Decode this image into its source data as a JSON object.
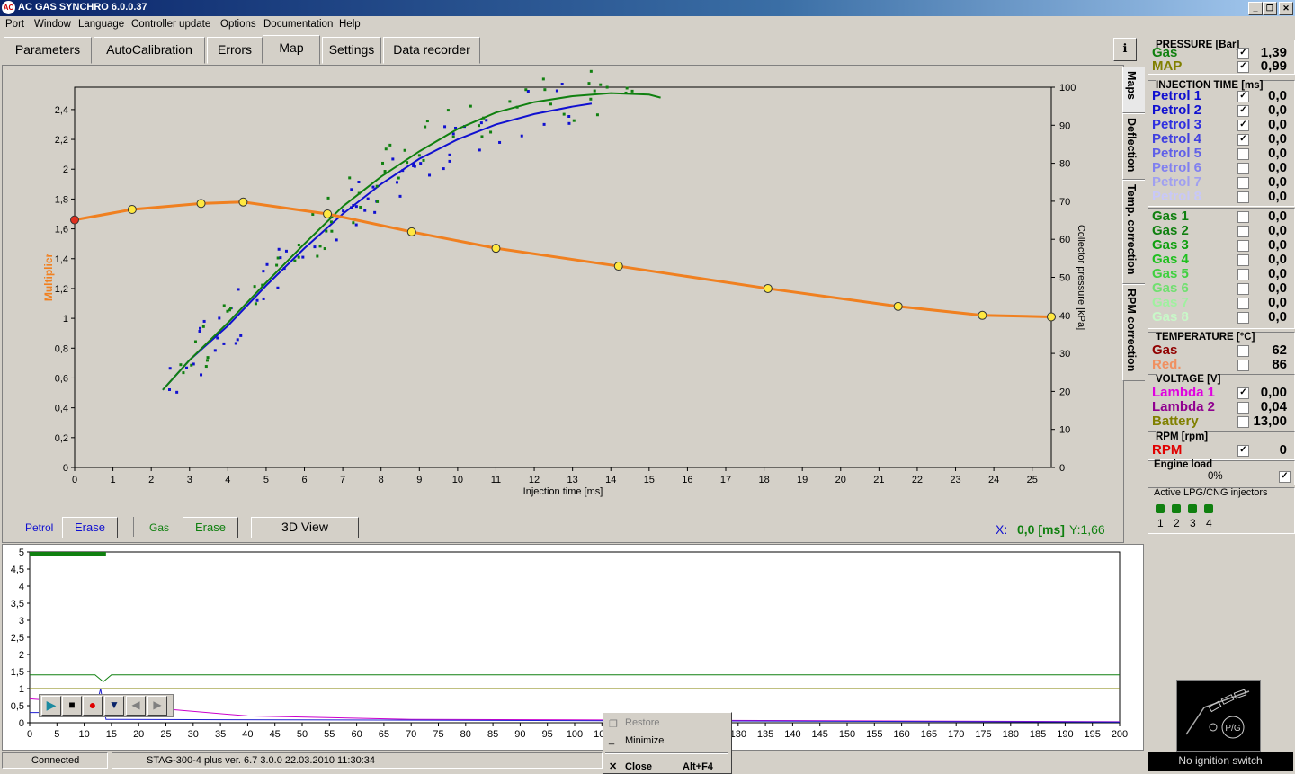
{
  "window": {
    "title": "AC GAS SYNCHRO  6.0.0.37",
    "icon": "AC"
  },
  "menu": [
    "Port",
    "Window",
    "Language",
    "Controller update",
    "Options",
    "Documentation",
    "Help"
  ],
  "tabs": [
    "Parameters",
    "AutoCalibration",
    "Errors",
    "Map",
    "Settings",
    "Data recorder"
  ],
  "active_tab": "Map",
  "vertical_tabs": [
    "Maps",
    "Deflection",
    "Temp. correction",
    "RPM correction"
  ],
  "chart_data": [
    {
      "type": "line",
      "xlabel": "Injection time [ms]",
      "ylabel": "Multiplier",
      "y2label": "Collector pressure [kPa]",
      "xlim": [
        0,
        25.5
      ],
      "ylim": [
        0,
        2.55
      ],
      "y2lim": [
        0,
        100
      ],
      "x_ticks": [
        0,
        1,
        2,
        3,
        4,
        5,
        6,
        7,
        8,
        9,
        10,
        11,
        12,
        13,
        14,
        15,
        16,
        17,
        18,
        19,
        20,
        21,
        22,
        23,
        24,
        25
      ],
      "y_ticks": [
        "0",
        "0,2",
        "0,4",
        "0,6",
        "0,8",
        "1",
        "1,2",
        "1,4",
        "1,6",
        "1,8",
        "2",
        "2,2",
        "2,4"
      ],
      "y2_ticks": [
        "0",
        "10",
        "20",
        "30",
        "40",
        "50",
        "60",
        "70",
        "80",
        "90",
        "100"
      ],
      "multiplier_curve": {
        "color": "#f08020",
        "points": [
          [
            0,
            1.66
          ],
          [
            1.5,
            1.73
          ],
          [
            3.3,
            1.77
          ],
          [
            4.4,
            1.78
          ],
          [
            6.6,
            1.7
          ],
          [
            8.8,
            1.58
          ],
          [
            11,
            1.47
          ],
          [
            14.2,
            1.35
          ],
          [
            18.1,
            1.2
          ],
          [
            21.5,
            1.08
          ],
          [
            23.7,
            1.02
          ],
          [
            25.5,
            1.01
          ]
        ]
      },
      "series": [
        {
          "name": "Petrol",
          "color": "#1010d0",
          "trend": [
            [
              2.3,
              0.52
            ],
            [
              3,
              0.72
            ],
            [
              4,
              0.95
            ],
            [
              5,
              1.22
            ],
            [
              6,
              1.47
            ],
            [
              7,
              1.7
            ],
            [
              8,
              1.9
            ],
            [
              9,
              2.07
            ],
            [
              10,
              2.2
            ],
            [
              11,
              2.3
            ],
            [
              12,
              2.37
            ],
            [
              13,
              2.42
            ],
            [
              13.5,
              2.44
            ]
          ]
        },
        {
          "name": "Gas",
          "color": "#108010",
          "trend": [
            [
              2.3,
              0.52
            ],
            [
              3,
              0.72
            ],
            [
              4,
              0.97
            ],
            [
              5,
              1.24
            ],
            [
              6,
              1.5
            ],
            [
              7,
              1.75
            ],
            [
              8,
              1.95
            ],
            [
              9,
              2.12
            ],
            [
              10,
              2.27
            ],
            [
              11,
              2.38
            ],
            [
              12,
              2.45
            ],
            [
              13,
              2.49
            ],
            [
              14,
              2.51
            ],
            [
              15,
              2.5
            ],
            [
              15.3,
              2.48
            ]
          ]
        }
      ]
    },
    {
      "type": "line",
      "xlim": [
        0,
        200
      ],
      "ylim": [
        0,
        5
      ],
      "x_ticks": [
        0,
        5,
        10,
        15,
        20,
        25,
        30,
        35,
        40,
        45,
        50,
        55,
        60,
        65,
        70,
        75,
        80,
        85,
        90,
        95,
        100,
        105,
        110,
        115,
        120,
        125,
        130,
        135,
        140,
        145,
        150,
        155,
        160,
        165,
        170,
        175,
        180,
        185,
        190,
        195,
        200
      ],
      "y_ticks": [
        "0",
        "0,5",
        "1",
        "1,5",
        "2",
        "2,5",
        "3",
        "3,5",
        "4",
        "4,5",
        "5"
      ],
      "series": [
        {
          "color": "#108010",
          "points": [
            [
              0,
              1.4
            ],
            [
              12,
              1.4
            ],
            [
              13.5,
              1.2
            ],
            [
              15,
              1.4
            ],
            [
              200,
              1.4
            ]
          ]
        },
        {
          "color": "#808000",
          "points": [
            [
              0,
              1.0
            ],
            [
              200,
              1.0
            ]
          ]
        },
        {
          "color": "#cc00cc",
          "points": [
            [
              0,
              0.7
            ],
            [
              25,
              0.4
            ],
            [
              40,
              0.2
            ],
            [
              70,
              0.1
            ],
            [
              200,
              0.03
            ]
          ]
        },
        {
          "color": "#2020d0",
          "points": [
            [
              0,
              0.3
            ],
            [
              12,
              0.3
            ],
            [
              13,
              1.0
            ],
            [
              14,
              0.1
            ],
            [
              200,
              0.02
            ]
          ]
        }
      ]
    }
  ],
  "chart_controls": {
    "petrol_label": "Petrol",
    "erase1": "Erase",
    "gas_label": "Gas",
    "erase2": "Erase",
    "view3d": "3D View",
    "cursor_x_label": "X:",
    "cursor_x": "0,0 [ms]",
    "cursor_y": "Y:1,66"
  },
  "pressure": {
    "title": "PRESSURE [Bar]",
    "rows": [
      {
        "label": "Gas",
        "color": "#108010",
        "checked": true,
        "value": "1,39"
      },
      {
        "label": "MAP",
        "color": "#808000",
        "checked": true,
        "value": "0,99"
      }
    ]
  },
  "injection": {
    "title": "INJECTION TIME [ms]",
    "rows": [
      {
        "label": "Petrol 1",
        "color": "#1010d0",
        "checked": true,
        "value": "0,0"
      },
      {
        "label": "Petrol 2",
        "color": "#1010d0",
        "checked": true,
        "value": "0,0"
      },
      {
        "label": "Petrol 3",
        "color": "#3030e0",
        "checked": true,
        "value": "0,0"
      },
      {
        "label": "Petrol 4",
        "color": "#4040e0",
        "checked": true,
        "value": "0,0"
      },
      {
        "label": "Petrol 5",
        "color": "#6060e8",
        "checked": false,
        "value": "0,0"
      },
      {
        "label": "Petrol 6",
        "color": "#8080f0",
        "checked": false,
        "value": "0,0"
      },
      {
        "label": "Petrol 7",
        "color": "#a0a0f0",
        "checked": false,
        "value": "0,0"
      },
      {
        "label": "Petrol 8",
        "color": "#c8c8f8",
        "checked": false,
        "value": "0,0"
      }
    ],
    "gas_rows": [
      {
        "label": "Gas 1",
        "color": "#108010",
        "checked": false,
        "value": "0,0"
      },
      {
        "label": "Gas 2",
        "color": "#108010",
        "checked": false,
        "value": "0,0"
      },
      {
        "label": "Gas 3",
        "color": "#10a010",
        "checked": false,
        "value": "0,0"
      },
      {
        "label": "Gas 4",
        "color": "#20c020",
        "checked": false,
        "value": "0,0"
      },
      {
        "label": "Gas 5",
        "color": "#40d040",
        "checked": false,
        "value": "0,0"
      },
      {
        "label": "Gas 6",
        "color": "#70e070",
        "checked": false,
        "value": "0,0"
      },
      {
        "label": "Gas 7",
        "color": "#a0f0a0",
        "checked": false,
        "value": "0,0"
      },
      {
        "label": "Gas 8",
        "color": "#c8f8c8",
        "checked": false,
        "value": "0,0"
      }
    ]
  },
  "temperature": {
    "title": "TEMPERATURE [°C]",
    "rows": [
      {
        "label": "Gas",
        "color": "#900000",
        "checked": false,
        "value": "62"
      },
      {
        "label": "Red.",
        "color": "#f09060",
        "checked": false,
        "value": "86"
      }
    ]
  },
  "voltage": {
    "title": "VOLTAGE [V]",
    "rows": [
      {
        "label": "Lambda 1",
        "color": "#e000e0",
        "checked": true,
        "value": "0,00"
      },
      {
        "label": "Lambda 2",
        "color": "#900090",
        "checked": false,
        "value": "0,04"
      },
      {
        "label": "Battery",
        "color": "#808000",
        "checked": false,
        "value": "13,00"
      }
    ]
  },
  "rpm": {
    "title": "RPM [rpm]",
    "rows": [
      {
        "label": "RPM",
        "color": "#e00000",
        "checked": true,
        "value": "0"
      }
    ]
  },
  "engine_load": {
    "title": "Engine load",
    "value": "0%",
    "checked": true
  },
  "injectors": {
    "title": "Active LPG/CNG injectors",
    "labels": [
      "1",
      "2",
      "3",
      "4"
    ]
  },
  "ignition": {
    "status": "No ignition switch",
    "logo": "P/G"
  },
  "status": {
    "connection": "Connected",
    "device": "STAG-300-4 plus   ver. 6.7  3.0.0    22.03.2010 11:30:34"
  },
  "context_menu": {
    "restore": "Restore",
    "minimize": "Minimize",
    "close": "Close",
    "close_shortcut": "Alt+F4"
  }
}
